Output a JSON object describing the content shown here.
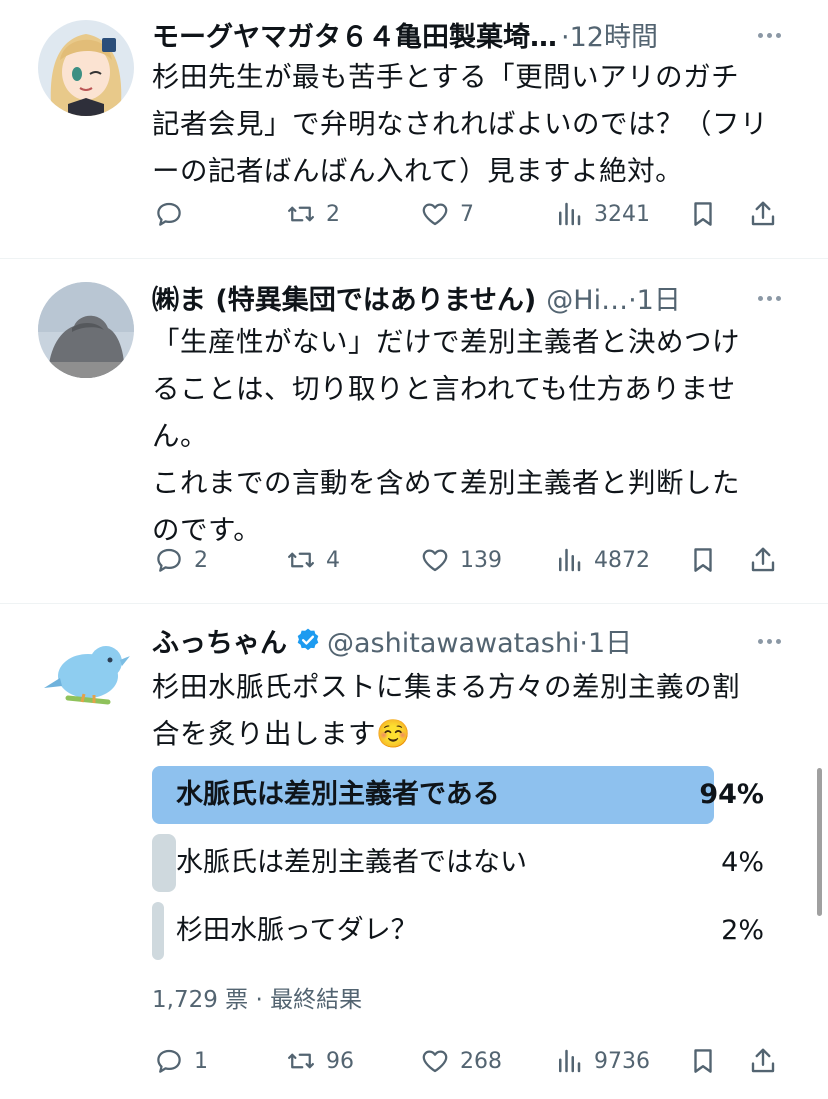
{
  "tweets": [
    {
      "name": "モーグヤマガタ６４亀田製菓埼…",
      "meta": "·12時間",
      "text": "杉田先生が最も苦手とする「更問いアリのガチ\n記者会見」で弁明なされればよいのでは？（フリ\nーの記者ばんばん入れて）見ますよ絶対。",
      "replies": "",
      "retweets": "2",
      "likes": "7",
      "views": "3241"
    },
    {
      "name": "㈱ま (特異集団ではありません)",
      "meta": "@Hi…·1日",
      "text": "「生産性がない」だけで差別主義者と決めつけ\nることは、切り取りと言われても仕方ありませ\nん。\nこれまでの言動を含めて差別主義者と判断した\nのです。",
      "replies": "2",
      "retweets": "4",
      "likes": "139",
      "views": "4872"
    },
    {
      "name": "ふっちゃん",
      "meta": "@ashitawawatashi·1日",
      "text": "杉田水脈氏ポストに集まる方々の差別主義の割\n合を炙り出します☺️",
      "replies": "1",
      "retweets": "96",
      "likes": "268",
      "views": "9736",
      "poll": {
        "options": [
          {
            "label": "水脈氏は差別主義者である",
            "percent_text": "94%",
            "percent": 94,
            "winner": true
          },
          {
            "label": "水脈氏は差別主義者ではない",
            "percent_text": "4%",
            "percent": 4,
            "winner": false
          },
          {
            "label": "杉田水脈ってダレ？",
            "percent_text": "2%",
            "percent": 2,
            "winner": false
          }
        ],
        "votes": "1,729 票",
        "status": "· 最終結果"
      }
    }
  ],
  "colors": {
    "poll_winner": "#8ec1ee",
    "poll_other": "#cfd9de",
    "icon": "#536471",
    "verified": "#1d9bf0"
  }
}
